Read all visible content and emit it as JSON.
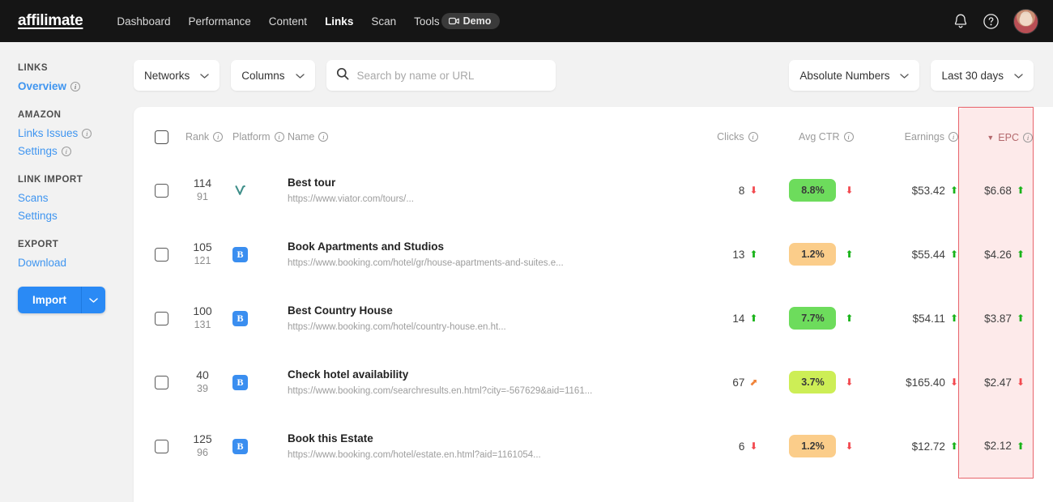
{
  "header": {
    "brand": "affilimate",
    "nav": [
      {
        "label": "Dashboard",
        "active": false
      },
      {
        "label": "Performance",
        "active": false
      },
      {
        "label": "Content",
        "active": false
      },
      {
        "label": "Links",
        "active": true
      },
      {
        "label": "Scan",
        "active": false
      },
      {
        "label": "Tools",
        "active": false
      }
    ],
    "demo_label": "Demo",
    "notifications_icon": "bell-icon",
    "help_icon": "question-circle-icon",
    "avatar_icon": "user-avatar"
  },
  "sidebar": {
    "groups": [
      {
        "title": "LINKS",
        "items": [
          {
            "label": "Overview",
            "info": true,
            "bold": true
          }
        ]
      },
      {
        "title": "AMAZON",
        "items": [
          {
            "label": "Links Issues",
            "info": true,
            "bold": false
          },
          {
            "label": "Settings",
            "info": true,
            "bold": false
          }
        ]
      },
      {
        "title": "LINK IMPORT",
        "items": [
          {
            "label": "Scans",
            "info": false,
            "bold": false
          },
          {
            "label": "Settings",
            "info": false,
            "bold": false
          }
        ]
      },
      {
        "title": "EXPORT",
        "items": [
          {
            "label": "Download",
            "info": false,
            "bold": false
          }
        ]
      }
    ],
    "import_button": "Import",
    "import_caret_icon": "chevron-down-icon",
    "accent_color": "#3f95f0",
    "import_color": "#2a8af5"
  },
  "toolbar": {
    "networks_label": "Networks",
    "columns_label": "Columns",
    "search_placeholder": "Search by name or URL",
    "search_value": "",
    "search_icon": "search-icon",
    "numbers_mode": "Absolute Numbers",
    "date_range": "Last 30 days"
  },
  "table": {
    "columns": [
      {
        "key": "rank",
        "label": "Rank",
        "info": true,
        "align": "left"
      },
      {
        "key": "plat",
        "label": "Platform",
        "info": true,
        "align": "left"
      },
      {
        "key": "name",
        "label": "Name",
        "info": true,
        "align": "left"
      },
      {
        "key": "clicks",
        "label": "Clicks",
        "info": true,
        "align": "right"
      },
      {
        "key": "ctr",
        "label": "Avg CTR",
        "info": true,
        "align": "right"
      },
      {
        "key": "earn",
        "label": "Earnings",
        "info": true,
        "align": "right"
      },
      {
        "key": "epc",
        "label": "EPC",
        "info": true,
        "align": "right",
        "sorted": "desc",
        "highlight": true
      }
    ],
    "sort_icon": "caret-down-icon",
    "highlight_color": "#fdeaea",
    "highlight_border": "#e8636b",
    "rows": [
      {
        "rank": "114",
        "rank_sub": "91",
        "platform": "viator",
        "platform_icon": "viator-logo",
        "name": "Best tour",
        "url": "https://www.viator.com/tours/...",
        "clicks": "8",
        "clicks_trend": "down",
        "ctr": "8.8%",
        "ctr_color": "#6ddc5c",
        "ctr_trend": "down",
        "earnings": "$53.42",
        "earnings_trend": "up",
        "epc": "$6.68",
        "epc_trend": "up"
      },
      {
        "rank": "105",
        "rank_sub": "121",
        "platform": "booking",
        "platform_icon": "booking-logo",
        "name": "Book Apartments and Studios",
        "url": "https://www.booking.com/hotel/gr/house-apartments-and-suites.e...",
        "clicks": "13",
        "clicks_trend": "up",
        "ctr": "1.2%",
        "ctr_color": "#fbcd8a",
        "ctr_trend": "up",
        "earnings": "$55.44",
        "earnings_trend": "up",
        "epc": "$4.26",
        "epc_trend": "up"
      },
      {
        "rank": "100",
        "rank_sub": "131",
        "platform": "booking",
        "platform_icon": "booking-logo",
        "name": "Best Country House",
        "url": "https://www.booking.com/hotel/country-house.en.ht...",
        "clicks": "14",
        "clicks_trend": "up",
        "ctr": "7.7%",
        "ctr_color": "#6ddc5c",
        "ctr_trend": "up",
        "earnings": "$54.11",
        "earnings_trend": "up",
        "epc": "$3.87",
        "epc_trend": "up"
      },
      {
        "rank": "40",
        "rank_sub": "39",
        "platform": "booking",
        "platform_icon": "booking-logo",
        "name": "Check hotel availability",
        "url": "https://www.booking.com/searchresults.en.html?city=-567629&aid=1161...",
        "clicks": "67",
        "clicks_trend": "flat",
        "ctr": "3.7%",
        "ctr_color": "#cdee56",
        "ctr_trend": "down",
        "earnings": "$165.40",
        "earnings_trend": "down",
        "epc": "$2.47",
        "epc_trend": "down"
      },
      {
        "rank": "125",
        "rank_sub": "96",
        "platform": "booking",
        "platform_icon": "booking-logo",
        "name": "Book this Estate",
        "url": "https://www.booking.com/hotel/estate.en.html?aid=1161054...",
        "clicks": "6",
        "clicks_trend": "down",
        "ctr": "1.2%",
        "ctr_color": "#fbcd8a",
        "ctr_trend": "down",
        "earnings": "$12.72",
        "earnings_trend": "up",
        "epc": "$2.12",
        "epc_trend": "up"
      }
    ]
  }
}
